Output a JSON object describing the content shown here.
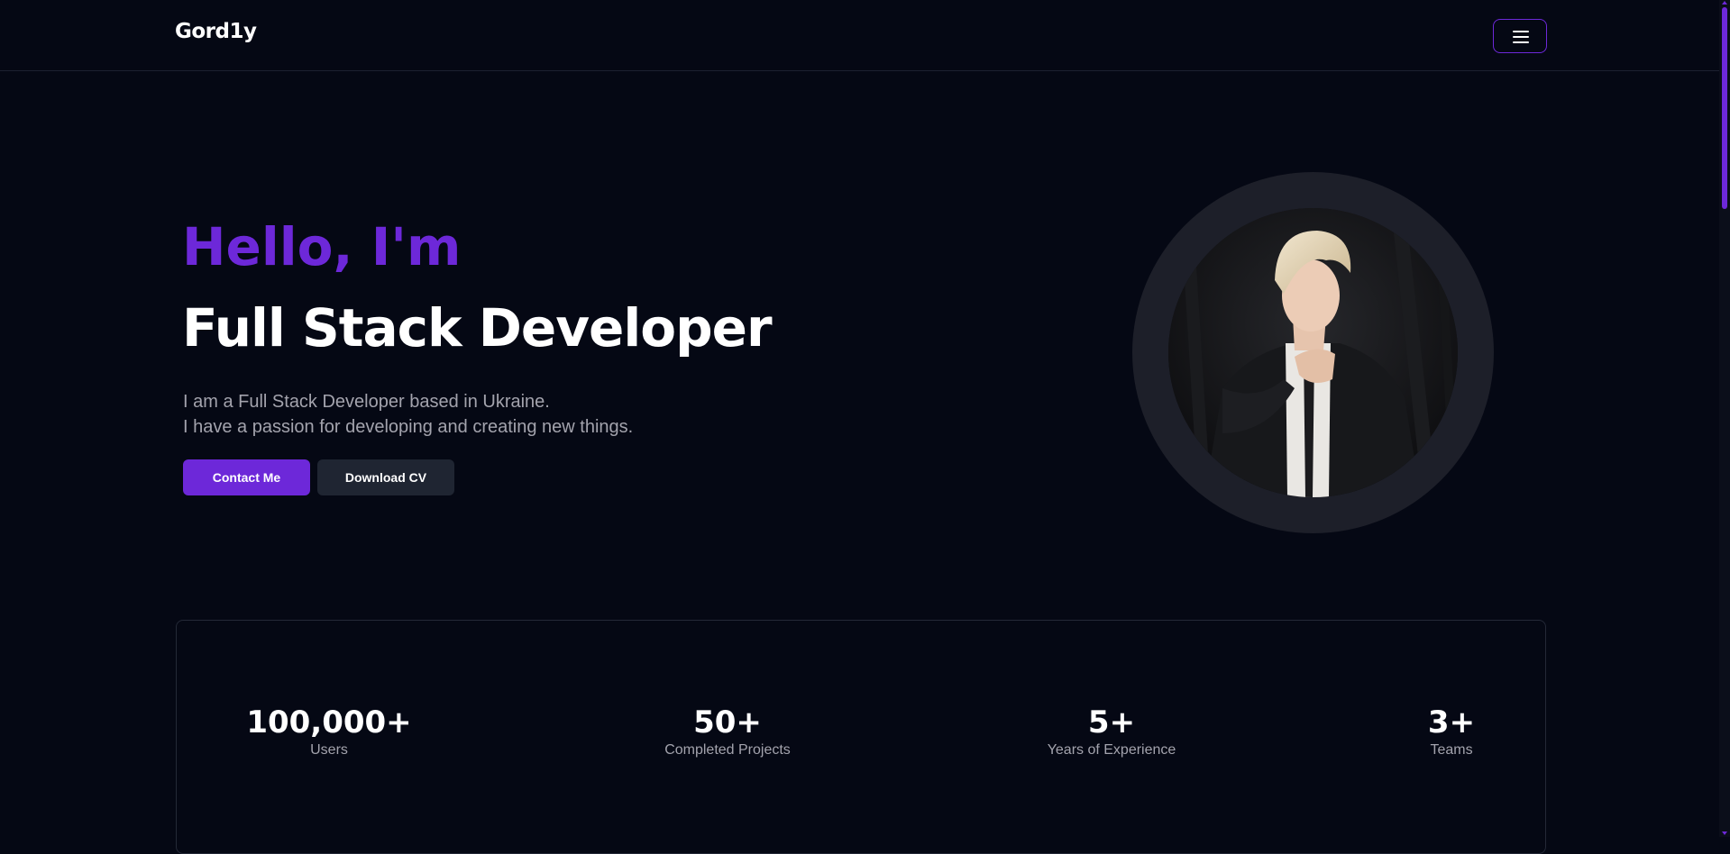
{
  "nav": {
    "brand": "Gord1y",
    "menu_icon": "hamburger-menu-icon"
  },
  "hero": {
    "greeting": "Hello, I'm",
    "title": "Full Stack Developer",
    "description_line1": "I am a Full Stack Developer based in Ukraine.",
    "description_line2": "I have a passion for developing and creating new things.",
    "contact_label": "Contact Me",
    "cv_label": "Download CV"
  },
  "stats": [
    {
      "value": "100,000+",
      "label": "Users"
    },
    {
      "value": "50+",
      "label": "Completed Projects"
    },
    {
      "value": "5+",
      "label": "Years of Experience"
    },
    {
      "value": "3+",
      "label": "Teams"
    }
  ],
  "colors": {
    "background": "#050814",
    "accent": "#6d28d9",
    "secondary_button": "#1f2532",
    "muted_text": "#a3a3ad"
  }
}
